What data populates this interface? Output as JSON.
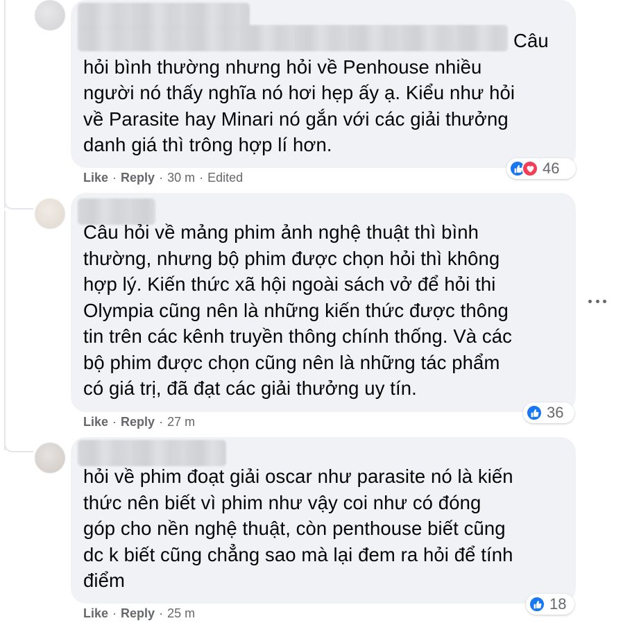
{
  "comments": [
    {
      "text_line1": "Câu",
      "text_rest": "hỏi bình thường nhưng hỏi về Penhouse nhiều\nngười nó thấy nghĩa nó hơi hẹp ấy ạ. Kiểu như hỏi\nvề Parasite hay Minari nó gắn với các giải thưởng\ndanh giá thì trông hợp lí hơn.",
      "like_label": "Like",
      "reply_label": "Reply",
      "time": "30 m",
      "edited": "Edited",
      "reaction_count": "46",
      "reactions": [
        "like-icon",
        "love-icon"
      ]
    },
    {
      "text": "Câu hỏi về mảng phim ảnh nghệ thuật thì bình\nthường, nhưng bộ phim được chọn hỏi thì không\nhợp lý. Kiến thức xã hội ngoài sách vở để hỏi thi\nOlympia cũng nên là những kiến thức được thông\ntin trên các kênh truyền thông chính thống. Và các\nbộ phim được chọn cũng nên là những tác phẩm\ncó giá trị, đã đạt các giải thưởng uy tín.",
      "like_label": "Like",
      "reply_label": "Reply",
      "time": "27 m",
      "reaction_count": "36",
      "reactions": [
        "like-icon"
      ]
    },
    {
      "text": "hỏi về phim đoạt giải oscar như parasite nó là kiến\nthức nên biết vì phim như vậy coi như có đóng\ngóp cho nền nghệ thuật, còn penthouse biết cũng\ndc k biết cũng chẳng sao mà lại đem ra hỏi để tính\nđiểm",
      "like_label": "Like",
      "reply_label": "Reply",
      "time": "25 m",
      "reaction_count": "18",
      "reactions": [
        "like-icon"
      ]
    }
  ],
  "separator": "·",
  "colors": {
    "bubble": "#f0f2f5",
    "text": "#050505",
    "meta": "#65676b",
    "like_blue": "#1877f2",
    "love_red": "#f33e58"
  }
}
